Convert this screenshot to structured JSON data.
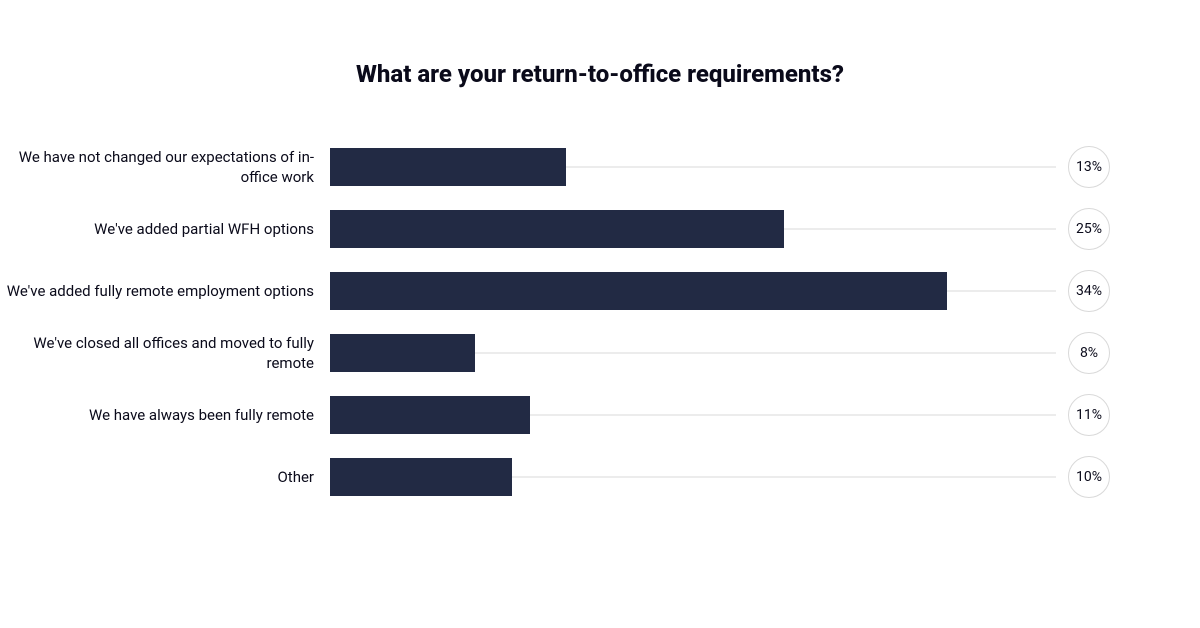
{
  "chart_data": {
    "type": "bar",
    "title": "What are your return-to-office requirements?",
    "categories": [
      "We have not changed our expectations of in-office work",
      "We've added partial WFH options",
      "We've added fully remote employment options",
      "We've closed all offices and moved to fully remote",
      "We have always been fully remote",
      "Other"
    ],
    "values": [
      13,
      25,
      34,
      8,
      11,
      10
    ],
    "value_labels": [
      "13%",
      "25%",
      "34%",
      "8%",
      "11%",
      "10%"
    ],
    "xlabel": "",
    "ylabel": "",
    "xlim": [
      0,
      40
    ],
    "colors": {
      "bar": "#222a44",
      "track": "#d9d9d9",
      "bubble_border": "#d9d9d9"
    }
  }
}
